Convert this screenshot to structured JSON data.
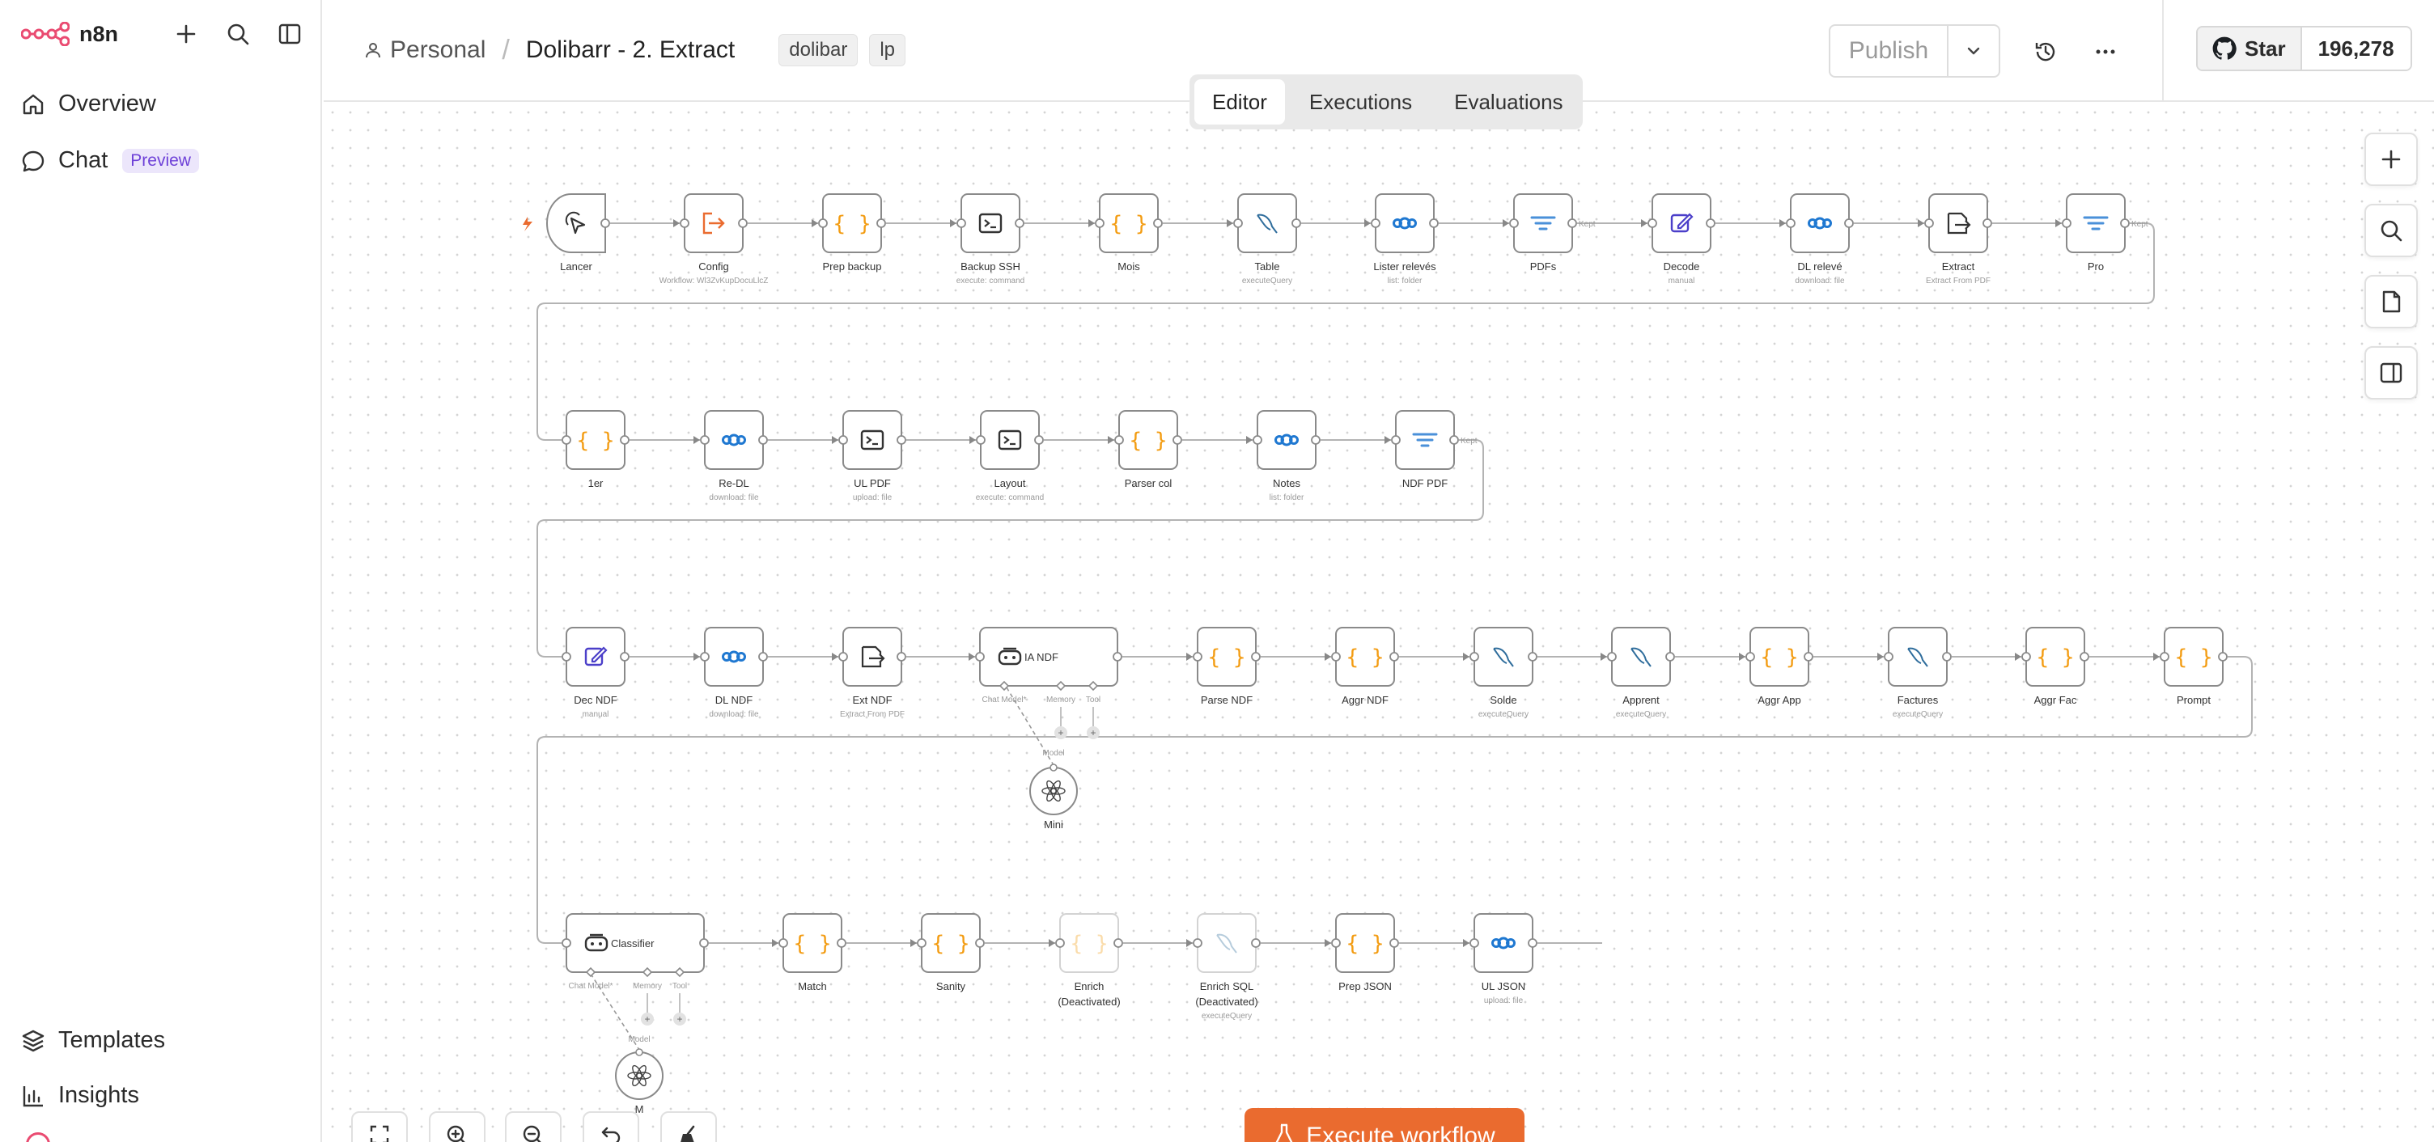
{
  "app": {
    "brand": "n8n"
  },
  "sidebar": {
    "nav": [
      {
        "label": "Overview",
        "icon": "home-icon"
      },
      {
        "label": "Chat",
        "icon": "chat-icon",
        "badge": "Preview"
      }
    ],
    "bottom": [
      {
        "label": "Templates",
        "icon": "templates-icon"
      },
      {
        "label": "Insights",
        "icon": "insights-icon"
      }
    ]
  },
  "header": {
    "project": "Personal",
    "workflow_title": "Dolibarr - 2. Extract",
    "tags": [
      "dolibar",
      "lp"
    ],
    "publish_label": "Publish"
  },
  "github": {
    "star_label": "Star",
    "count": "196,278"
  },
  "tabs": [
    {
      "label": "Editor",
      "active": true
    },
    {
      "label": "Executions",
      "active": false
    },
    {
      "label": "Evaluations",
      "active": false
    }
  ],
  "execute_label": "Execute workflow",
  "colors": {
    "accent": "#ea6b2f",
    "brand": "#ea4b71",
    "code": "#f39c12",
    "http": "#1f78d1",
    "edit": "#4b3fc9"
  },
  "nodes": [
    {
      "id": "lancer",
      "label": "Lancer",
      "sub": "",
      "icon": "cursor",
      "trigger": true
    },
    {
      "id": "config",
      "label": "Config",
      "sub": "Workflow: Wl3ZvKupDocuLlcZ",
      "icon": "execwf"
    },
    {
      "id": "prepbackup",
      "label": "Prep backup",
      "sub": "",
      "icon": "code"
    },
    {
      "id": "backupssh",
      "label": "Backup SSH",
      "sub": "execute: command",
      "icon": "terminal"
    },
    {
      "id": "mois",
      "label": "Mois",
      "sub": "",
      "icon": "code"
    },
    {
      "id": "table",
      "label": "Table",
      "sub": "executeQuery",
      "icon": "mysql"
    },
    {
      "id": "listerreleves",
      "label": "Lister relevés",
      "sub": "list: folder",
      "icon": "nextcloud"
    },
    {
      "id": "pdfs",
      "label": "PDFs",
      "sub": "",
      "icon": "filter",
      "kept": "Kept"
    },
    {
      "id": "decode",
      "label": "Decode",
      "sub": "manual",
      "icon": "edit"
    },
    {
      "id": "dlreleve",
      "label": "DL relevé",
      "sub": "download: file",
      "icon": "nextcloud"
    },
    {
      "id": "extract",
      "label": "Extract",
      "sub": "Extract From PDF",
      "icon": "extract"
    },
    {
      "id": "pro",
      "label": "Pro",
      "sub": "",
      "icon": "filter",
      "kept": "Kept"
    },
    {
      "id": "n1er",
      "label": "1er",
      "sub": "",
      "icon": "code"
    },
    {
      "id": "redl",
      "label": "Re-DL",
      "sub": "download: file",
      "icon": "nextcloud"
    },
    {
      "id": "ulpdf",
      "label": "UL PDF",
      "sub": "upload: file",
      "icon": "terminal"
    },
    {
      "id": "layout",
      "label": "Layout",
      "sub": "execute: command",
      "icon": "terminal"
    },
    {
      "id": "parsercol",
      "label": "Parser col",
      "sub": "",
      "icon": "code"
    },
    {
      "id": "notes",
      "label": "Notes",
      "sub": "list: folder",
      "icon": "nextcloud"
    },
    {
      "id": "ndfpdf",
      "label": "NDF PDF",
      "sub": "",
      "icon": "filter",
      "kept": "Kept"
    },
    {
      "id": "decndf",
      "label": "Dec NDF",
      "sub": "manual",
      "icon": "edit"
    },
    {
      "id": "dlndf",
      "label": "DL NDF",
      "sub": "download: file",
      "icon": "nextcloud"
    },
    {
      "id": "extndf",
      "label": "Ext NDF",
      "sub": "Extract From PDF",
      "icon": "extract"
    },
    {
      "id": "iandf",
      "label": "IA NDF",
      "sub": "",
      "icon": "agent",
      "agent": true
    },
    {
      "id": "parsendf",
      "label": "Parse NDF",
      "sub": "",
      "icon": "code"
    },
    {
      "id": "aggrndf",
      "label": "Aggr NDF",
      "sub": "",
      "icon": "code"
    },
    {
      "id": "solde",
      "label": "Solde",
      "sub": "executeQuery",
      "icon": "mysql"
    },
    {
      "id": "apprent",
      "label": "Apprent",
      "sub": "executeQuery",
      "icon": "mysql"
    },
    {
      "id": "aggrapp",
      "label": "Aggr App",
      "sub": "",
      "icon": "code"
    },
    {
      "id": "factures",
      "label": "Factures",
      "sub": "executeQuery",
      "icon": "mysql"
    },
    {
      "id": "aggrfac",
      "label": "Aggr Fac",
      "sub": "",
      "icon": "code"
    },
    {
      "id": "prompt",
      "label": "Prompt",
      "sub": "",
      "icon": "code"
    },
    {
      "id": "mini",
      "label": "Mini",
      "sub": "",
      "icon": "openai",
      "model": true
    },
    {
      "id": "classifier",
      "label": "Classifier",
      "sub": "",
      "icon": "agent",
      "agent": true
    },
    {
      "id": "match",
      "label": "Match",
      "sub": "",
      "icon": "code"
    },
    {
      "id": "sanity",
      "label": "Sanity",
      "sub": "",
      "icon": "code"
    },
    {
      "id": "enrich",
      "label": "Enrich",
      "label2": "(Deactivated)",
      "sub": "",
      "icon": "code",
      "disabled": true
    },
    {
      "id": "enrichsql",
      "label": "Enrich SQL",
      "label2": "(Deactivated)",
      "sub": "executeQuery",
      "icon": "mysql",
      "disabled": true
    },
    {
      "id": "prepjson",
      "label": "Prep JSON",
      "sub": "",
      "icon": "code"
    },
    {
      "id": "uljson",
      "label": "UL JSON",
      "sub": "upload: file",
      "icon": "nextcloud"
    },
    {
      "id": "m",
      "label": "M",
      "sub": "",
      "icon": "openai",
      "model": true
    }
  ],
  "agent_ports": {
    "chat_model": "Chat Model*",
    "memory": "Memory",
    "tool": "Tool",
    "model": "Model"
  }
}
